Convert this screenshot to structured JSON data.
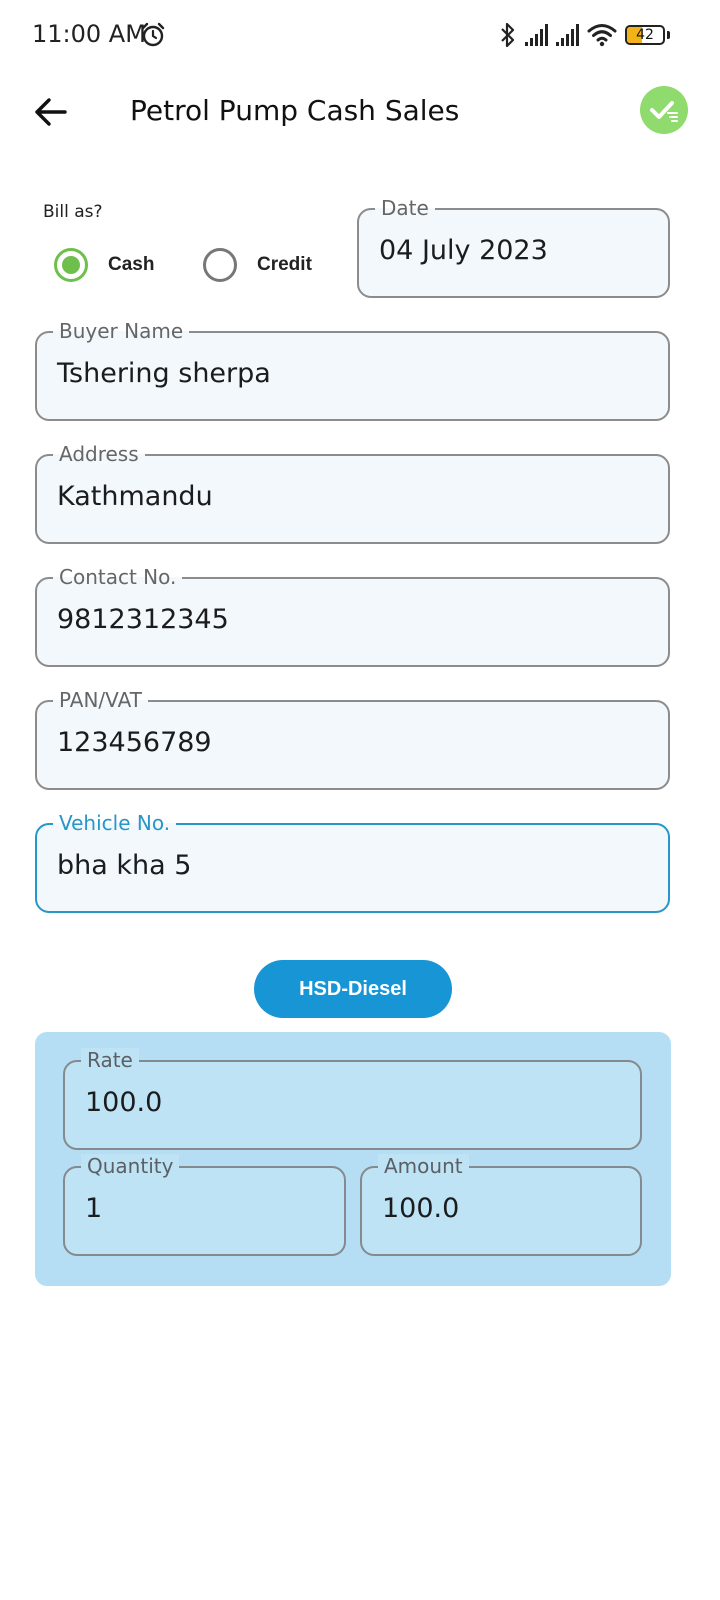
{
  "status_bar": {
    "time": "11:00 AM",
    "battery_level": "42",
    "icons": [
      "alarm-icon",
      "bluetooth-icon",
      "signal-icon",
      "signal-icon",
      "wifi-icon",
      "battery-icon"
    ]
  },
  "app_bar": {
    "title": "Petrol Pump Cash Sales",
    "back_icon": "arrow-left-icon",
    "save_icon": "check-icon"
  },
  "bill_as": {
    "label": "Bill as?",
    "options": [
      {
        "label": "Cash",
        "selected": true
      },
      {
        "label": "Credit",
        "selected": false
      }
    ]
  },
  "form": {
    "date": {
      "label": "Date",
      "value": "04 July 2023"
    },
    "buyer_name": {
      "label": "Buyer Name",
      "value": "Tshering sherpa"
    },
    "address": {
      "label": "Address",
      "value": "Kathmandu"
    },
    "contact": {
      "label": "Contact No.",
      "value": "9812312345"
    },
    "pan_vat": {
      "label": "PAN/VAT",
      "value": "123456789"
    },
    "vehicle": {
      "label": "Vehicle No.",
      "value": "bha kha 5"
    }
  },
  "fuel": {
    "type_label": "HSD-Diesel",
    "rate": {
      "label": "Rate",
      "value": "100.0"
    },
    "quantity": {
      "label": "Quantity",
      "value": "1"
    },
    "amount": {
      "label": "Amount",
      "value": "100.0"
    }
  },
  "colors": {
    "accent": "#1795d4",
    "radio_selected": "#6fbf4c",
    "save_button": "#8fdb6d",
    "panel_background": "#b5def4",
    "focused_border": "#2796c8"
  }
}
